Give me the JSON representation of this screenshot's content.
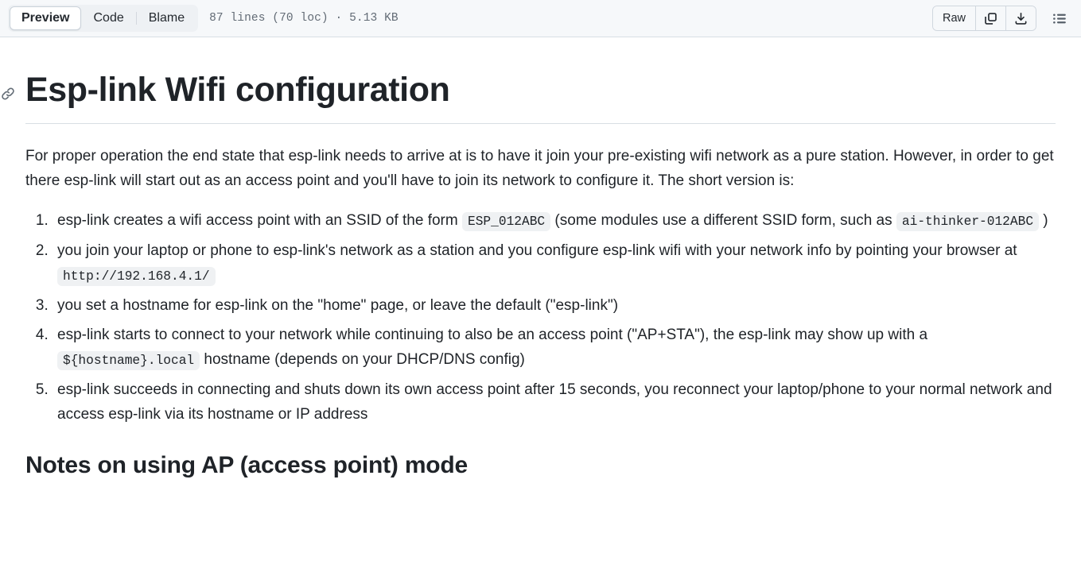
{
  "header": {
    "tabs": [
      {
        "label": "Preview",
        "active": true
      },
      {
        "label": "Code",
        "active": false
      },
      {
        "label": "Blame",
        "active": false
      }
    ],
    "file_meta": "87 lines (70 loc) · 5.13 KB",
    "raw_button": "Raw",
    "copy_icon_name": "copy-icon",
    "download_icon_name": "download-icon",
    "outline_icon_name": "outline-list-icon"
  },
  "article": {
    "title": "Esp-link Wifi configuration",
    "anchor_icon_name": "link-icon",
    "lead": "For proper operation the end state that esp-link needs to arrive at is to have it join your pre-existing wifi network as a pure station. However, in order to get there esp-link will start out as an access point and you'll have to join its network to configure it. The short version is:",
    "steps": [
      {
        "parts": [
          {
            "t": "text",
            "v": "esp-link creates a wifi access point with an SSID of the form "
          },
          {
            "t": "code",
            "v": "ESP_012ABC"
          },
          {
            "t": "text",
            "v": " (some modules use a different SSID form, such as "
          },
          {
            "t": "code",
            "v": "ai-thinker-012ABC"
          },
          {
            "t": "text",
            "v": " )"
          }
        ]
      },
      {
        "parts": [
          {
            "t": "text",
            "v": "you join your laptop or phone to esp-link's network as a station and you configure esp-link wifi with your network info by pointing your browser at "
          },
          {
            "t": "code",
            "v": "http://192.168.4.1/"
          }
        ]
      },
      {
        "parts": [
          {
            "t": "text",
            "v": "you set a hostname for esp-link on the \"home\" page, or leave the default (\"esp-link\")"
          }
        ]
      },
      {
        "parts": [
          {
            "t": "text",
            "v": "esp-link starts to connect to your network while continuing to also be an access point (\"AP+STA\"), the esp-link may show up with a "
          },
          {
            "t": "code",
            "v": "${hostname}.local"
          },
          {
            "t": "text",
            "v": " hostname (depends on your DHCP/DNS config)"
          }
        ]
      },
      {
        "parts": [
          {
            "t": "text",
            "v": "esp-link succeeds in connecting and shuts down its own access point after 15 seconds, you reconnect your laptop/phone to your normal network and access esp-link via its hostname or IP address"
          }
        ]
      }
    ],
    "subheading": "Notes on using AP (access point) mode"
  },
  "colors": {
    "header_bg": "#f6f8fa",
    "border": "#d8dee4",
    "text": "#1f2328",
    "muted": "#636c76",
    "code_bg": "#eff1f3",
    "segment_bg": "#eef1f4"
  }
}
